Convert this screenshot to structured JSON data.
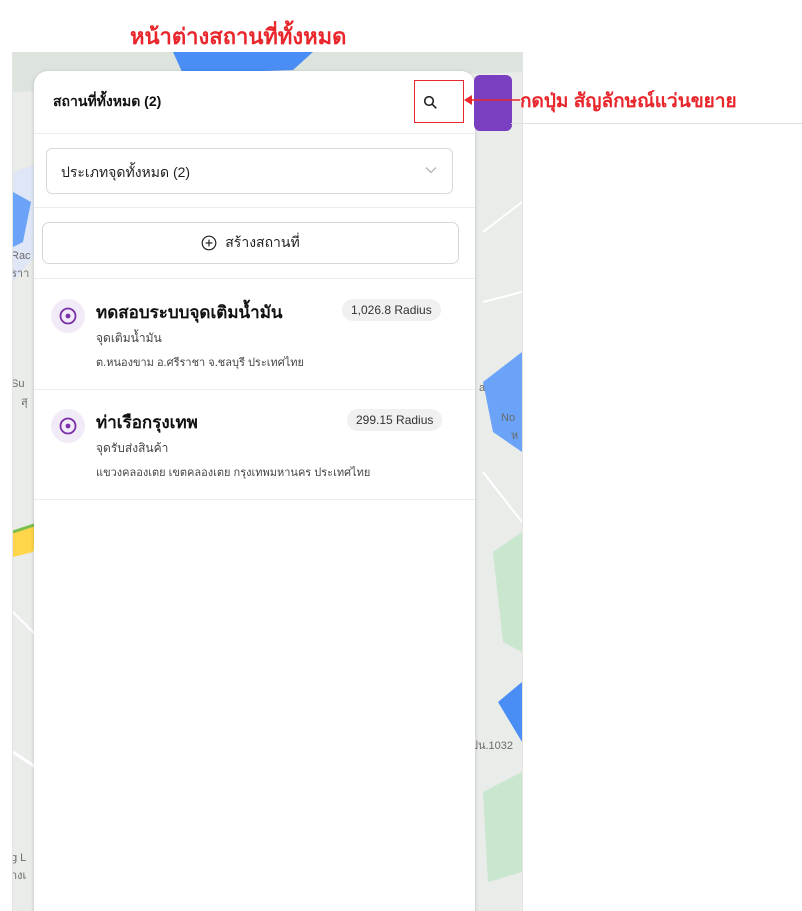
{
  "annotations": {
    "title": "หน้าต่างสถานที่ทั้งหมด",
    "instruction": "กดปุ่ม สัญลักษณ์แว่นขยาย"
  },
  "map": {
    "labels": [
      "Rac",
      "ราา",
      "Su",
      "สุ",
      "a",
      "No",
      "ห",
      "ปน.1032",
      "g L",
      "างเ"
    ]
  },
  "panel": {
    "title": "สถานที่ทั้งหมด (2)",
    "search_icon": "search-icon",
    "filter": {
      "value": "ประเภทจุดทั้งหมด (2)",
      "icon": "chevron-down-icon"
    },
    "create_button": {
      "label": "สร้างสถานที่",
      "icon": "plus-circle-icon"
    }
  },
  "places": [
    {
      "name": "ทดสอบระบบจุดเติมน้ำมัน",
      "type": "จุดเติมน้ำมัน",
      "address": "ต.หนองขาม อ.ศรีราชา จ.ชลบุรี ประเทศไทย",
      "radius": "1,026.8 Radius",
      "icon": "target-icon"
    },
    {
      "name": "ท่าเรือกรุงเทพ",
      "type": "จุดรับส่งสินค้า",
      "address": "แขวงคลองเตย เขตคลองเตย กรุงเทพมหานคร ประเทศไทย",
      "radius": "299.15 Radius",
      "icon": "target-icon"
    }
  ],
  "colors": {
    "accent": "#7a3fc0",
    "annotation": "#e8262b",
    "icon_purple": "#7b2fa8"
  }
}
